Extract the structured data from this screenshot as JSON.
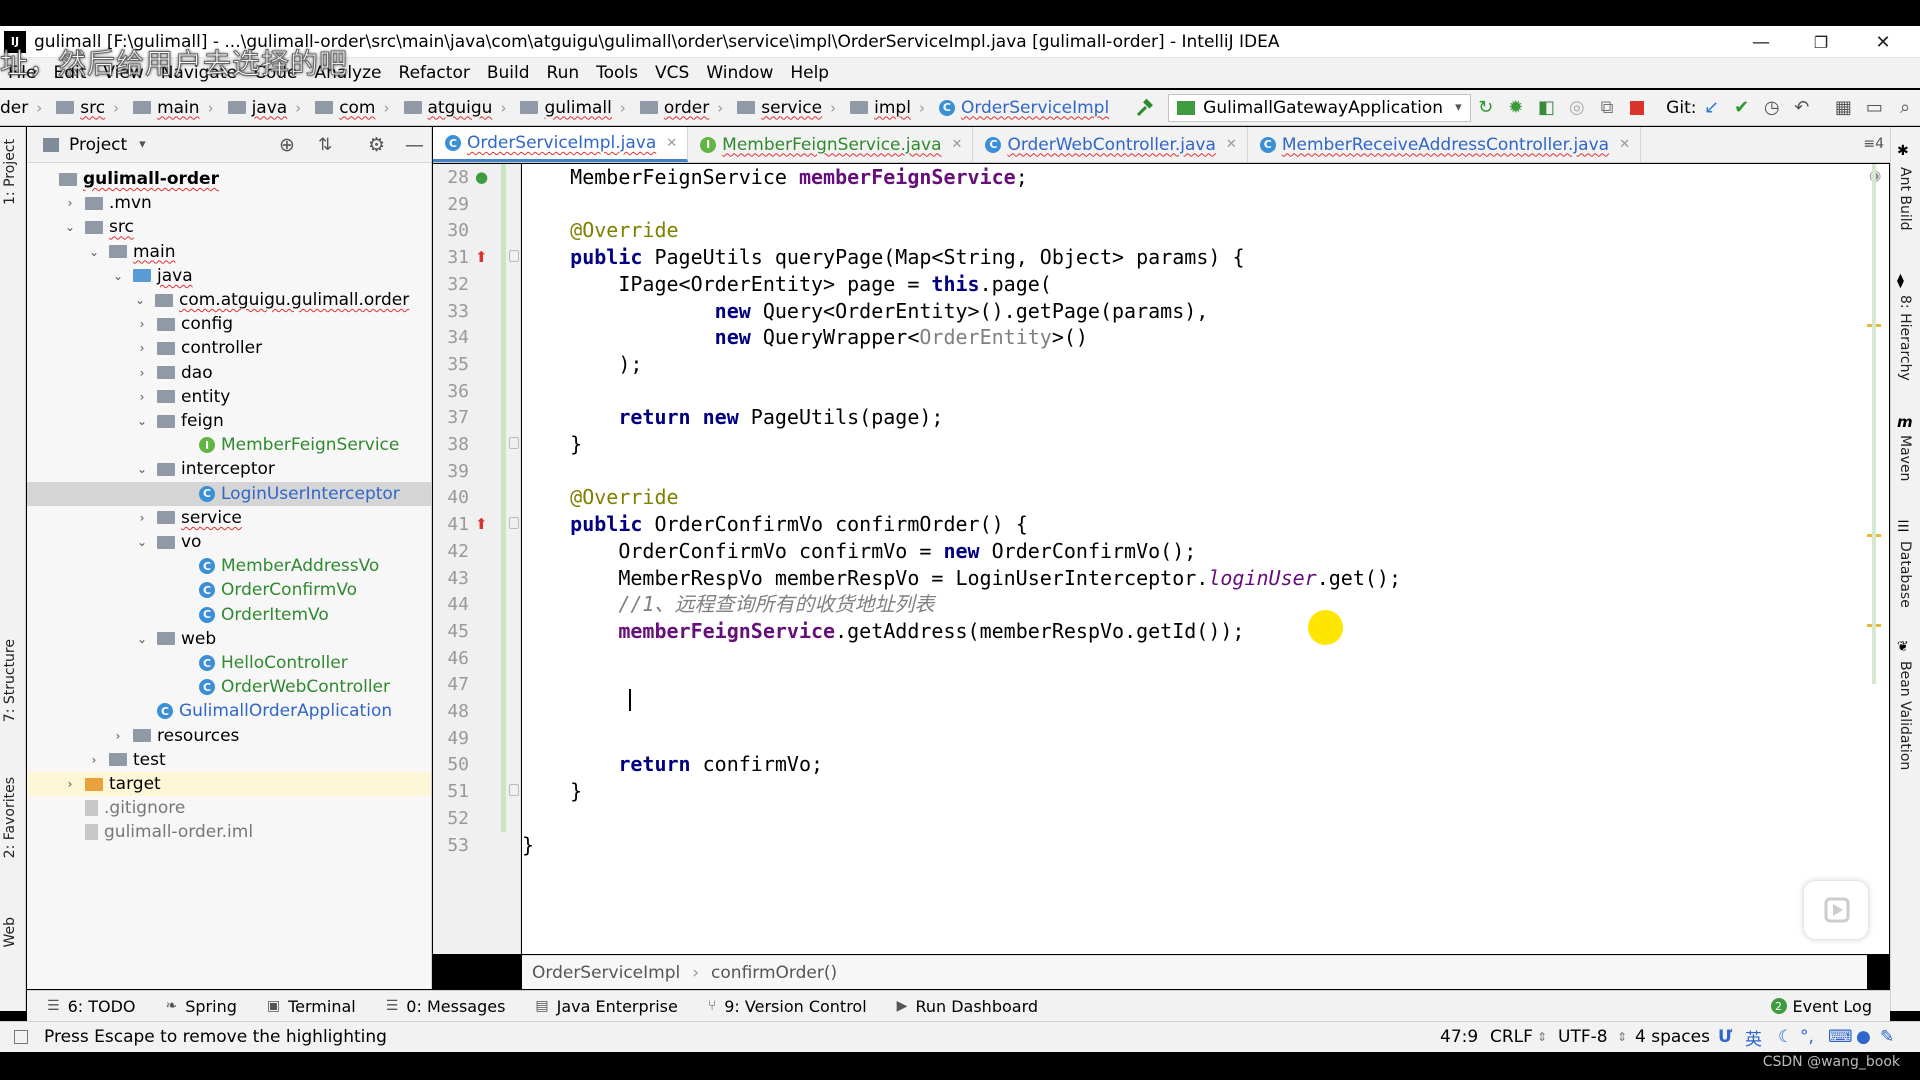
{
  "window": {
    "title": "gulimall [F:\\gulimall] - ...\\gulimall-order\\src\\main\\java\\com\\atguigu\\gulimall\\order\\service\\impl\\OrderServiceImpl.java [gulimall-order] - IntelliJ IDEA",
    "app_icon": "IJ",
    "minimize": "—",
    "restore": "❐",
    "close": "✕"
  },
  "subtitle_overlay": "址，然后给用户去选择的吧",
  "menu": [
    "File",
    "Edit",
    "View",
    "Navigate",
    "Code",
    "Analyze",
    "Refactor",
    "Build",
    "Run",
    "Tools",
    "VCS",
    "Window",
    "Help"
  ],
  "navbar": {
    "crumbs": [
      "der",
      "src",
      "main",
      "java",
      "com",
      "atguigu",
      "gulimall",
      "order",
      "service",
      "impl",
      "OrderServiceImpl"
    ],
    "run_config": "GulimallGatewayApplication",
    "git_label": "Git:"
  },
  "project_panel": {
    "title": "Project",
    "tree": [
      {
        "label": "gulimall-order",
        "depth": 0,
        "arrow": "",
        "icon": "module"
      },
      {
        "label": ".mvn",
        "depth": 1,
        "arrow": "›",
        "icon": "folder"
      },
      {
        "label": "src",
        "depth": 1,
        "arrow": "⌄",
        "icon": "folder"
      },
      {
        "label": "main",
        "depth": 2,
        "arrow": "⌄",
        "icon": "folder"
      },
      {
        "label": "java",
        "depth": 3,
        "arrow": "⌄",
        "icon": "folder-blue"
      },
      {
        "label": "com.atguigu.gulimall.order",
        "depth": 4,
        "arrow": "⌄",
        "icon": "folder"
      },
      {
        "label": "config",
        "depth": 5,
        "arrow": "›",
        "icon": "folder"
      },
      {
        "label": "controller",
        "depth": 5,
        "arrow": "›",
        "icon": "folder"
      },
      {
        "label": "dao",
        "depth": 5,
        "arrow": "›",
        "icon": "folder"
      },
      {
        "label": "entity",
        "depth": 5,
        "arrow": "›",
        "icon": "folder"
      },
      {
        "label": "feign",
        "depth": 5,
        "arrow": "⌄",
        "icon": "folder"
      },
      {
        "label": "MemberFeignService",
        "depth": 6,
        "arrow": "",
        "icon": "interface"
      },
      {
        "label": "interceptor",
        "depth": 5,
        "arrow": "⌄",
        "icon": "folder"
      },
      {
        "label": "LoginUserInterceptor",
        "depth": 6,
        "arrow": "",
        "icon": "class"
      },
      {
        "label": "service",
        "depth": 5,
        "arrow": "›",
        "icon": "folder"
      },
      {
        "label": "vo",
        "depth": 5,
        "arrow": "⌄",
        "icon": "folder"
      },
      {
        "label": "MemberAddressVo",
        "depth": 6,
        "arrow": "",
        "icon": "class"
      },
      {
        "label": "OrderConfirmVo",
        "depth": 6,
        "arrow": "",
        "icon": "class"
      },
      {
        "label": "OrderItemVo",
        "depth": 6,
        "arrow": "",
        "icon": "class"
      },
      {
        "label": "web",
        "depth": 5,
        "arrow": "⌄",
        "icon": "folder"
      },
      {
        "label": "HelloController",
        "depth": 6,
        "arrow": "",
        "icon": "class"
      },
      {
        "label": "OrderWebController",
        "depth": 6,
        "arrow": "",
        "icon": "class"
      },
      {
        "label": "GulimallOrderApplication",
        "depth": 5,
        "arrow": "",
        "icon": "class"
      },
      {
        "label": "resources",
        "depth": 3,
        "arrow": "›",
        "icon": "folder"
      },
      {
        "label": "test",
        "depth": 2,
        "arrow": "›",
        "icon": "folder"
      },
      {
        "label": "target",
        "depth": 1,
        "arrow": "›",
        "icon": "folder-orange"
      },
      {
        "label": ".gitignore",
        "depth": 1,
        "arrow": "",
        "icon": "file"
      },
      {
        "label": "gulimall-order.iml",
        "depth": 1,
        "arrow": "",
        "icon": "file"
      }
    ]
  },
  "editor_tabs": [
    {
      "label": "OrderServiceImpl.java",
      "icon": "class",
      "active": true
    },
    {
      "label": "MemberFeignService.java",
      "icon": "interface",
      "active": false
    },
    {
      "label": "OrderWebController.java",
      "icon": "class",
      "active": false
    },
    {
      "label": "MemberReceiveAddressController.java",
      "icon": "class",
      "active": false
    }
  ],
  "tabs_extra": "≡4",
  "line_numbers": [
    "28",
    "29",
    "30",
    "31",
    "32",
    "33",
    "34",
    "35",
    "36",
    "37",
    "38",
    "39",
    "40",
    "41",
    "42",
    "43",
    "44",
    "45",
    "46",
    "47",
    "48",
    "49",
    "50",
    "51",
    "52",
    "53"
  ],
  "code_lines": [
    [
      {
        "t": "    MemberFeignService ",
        "c": ""
      },
      {
        "t": "memberFeignService",
        "c": "fd"
      },
      {
        "t": ";",
        "c": ""
      }
    ],
    [],
    [
      {
        "t": "    @Override",
        "c": "an"
      }
    ],
    [
      {
        "t": "    ",
        "c": ""
      },
      {
        "t": "public ",
        "c": "kw"
      },
      {
        "t": "PageUtils queryPage(Map<String, Object> params) {",
        "c": ""
      }
    ],
    [
      {
        "t": "        IPage<OrderEntity> page = ",
        "c": ""
      },
      {
        "t": "this",
        "c": "kw"
      },
      {
        "t": ".page(",
        "c": ""
      }
    ],
    [
      {
        "t": "                ",
        "c": ""
      },
      {
        "t": "new ",
        "c": "kw"
      },
      {
        "t": "Query<OrderEntity>().getPage(params),",
        "c": ""
      }
    ],
    [
      {
        "t": "                ",
        "c": ""
      },
      {
        "t": "new ",
        "c": "kw"
      },
      {
        "t": "QueryWrapper<",
        "c": ""
      },
      {
        "t": "OrderEntity",
        "c": "gr"
      },
      {
        "t": ">()",
        "c": ""
      }
    ],
    [
      {
        "t": "        );",
        "c": ""
      }
    ],
    [],
    [
      {
        "t": "        ",
        "c": ""
      },
      {
        "t": "return new ",
        "c": "kw"
      },
      {
        "t": "PageUtils(page);",
        "c": ""
      }
    ],
    [
      {
        "t": "    }",
        "c": ""
      }
    ],
    [],
    [
      {
        "t": "    @Override",
        "c": "an"
      }
    ],
    [
      {
        "t": "    ",
        "c": ""
      },
      {
        "t": "public ",
        "c": "kw"
      },
      {
        "t": "OrderConfirmVo confirmOrder() {",
        "c": ""
      }
    ],
    [
      {
        "t": "        OrderConfirmVo confirmVo = ",
        "c": ""
      },
      {
        "t": "new ",
        "c": "kw"
      },
      {
        "t": "OrderConfirmVo();",
        "c": ""
      }
    ],
    [
      {
        "t": "        MemberRespVo memberRespVo = LoginUserInterceptor.",
        "c": ""
      },
      {
        "t": "loginUser",
        "c": "st"
      },
      {
        "t": ".get();",
        "c": ""
      }
    ],
    [
      {
        "t": "        //1、远程查询所有的收货地址列表",
        "c": "cm"
      }
    ],
    [
      {
        "t": "        ",
        "c": ""
      },
      {
        "t": "memberFeignService",
        "c": "fd"
      },
      {
        "t": ".getAddress(memberRespVo.getId());",
        "c": ""
      }
    ],
    [],
    [],
    [],
    [],
    [
      {
        "t": "        ",
        "c": ""
      },
      {
        "t": "return ",
        "c": "kw"
      },
      {
        "t": "confirmVo;",
        "c": ""
      }
    ],
    [
      {
        "t": "    }",
        "c": ""
      }
    ],
    [],
    [
      {
        "t": "}",
        "c": ""
      }
    ]
  ],
  "editor_breadcrumb": [
    "OrderServiceImpl",
    "confirmOrder()"
  ],
  "left_tool_tabs": [
    "1: Project",
    "7: Structure",
    "2: Favorites",
    "Web"
  ],
  "right_tool_tabs": [
    "Ant Build",
    "8: Hierarchy",
    "Maven",
    "Database",
    "Bean Validation"
  ],
  "bottom_tabs": [
    {
      "label": "6: TODO",
      "icon": "☰"
    },
    {
      "label": "Spring",
      "icon": "❧"
    },
    {
      "label": "Terminal",
      "icon": "▣"
    },
    {
      "label": "0: Messages",
      "icon": "☰"
    },
    {
      "label": "Java Enterprise",
      "icon": "▤"
    },
    {
      "label": "9: Version Control",
      "icon": "⑂"
    },
    {
      "label": "Run Dashboard",
      "icon": "▶"
    }
  ],
  "event_log": "Event Log",
  "status": {
    "message": "Press Escape to remove the highlighting",
    "position": "47:9",
    "line_sep": "CRLF",
    "encoding": "UTF-8",
    "indent": "4 spaces",
    "ime": "英"
  },
  "watermark": "CSDN @wang_book",
  "colors": {
    "accent": "#4083c9",
    "keyword": "#000080",
    "field": "#660e7a",
    "annotation": "#808000",
    "highlight_dot": "#ffe600"
  }
}
